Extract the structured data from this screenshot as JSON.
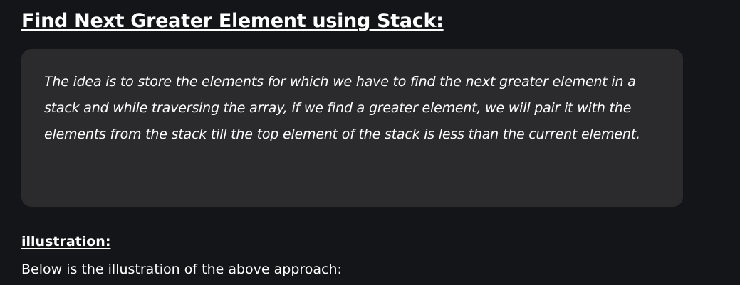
{
  "article": {
    "heading": "Find Next Greater Element using Stack:",
    "callout_text": "The idea is to store the elements for which we have to find the next greater element in a stack and while traversing the array, if we find a greater element, we will pair it with the elements from the stack till the top element of the stack is less than the current element.",
    "illustration_heading": "illustration:",
    "illustration_intro": "Below is the illustration of the above approach:"
  },
  "colors": {
    "background": "#141519",
    "callout_background": "#2b2b2e",
    "text": "#ffffff"
  }
}
